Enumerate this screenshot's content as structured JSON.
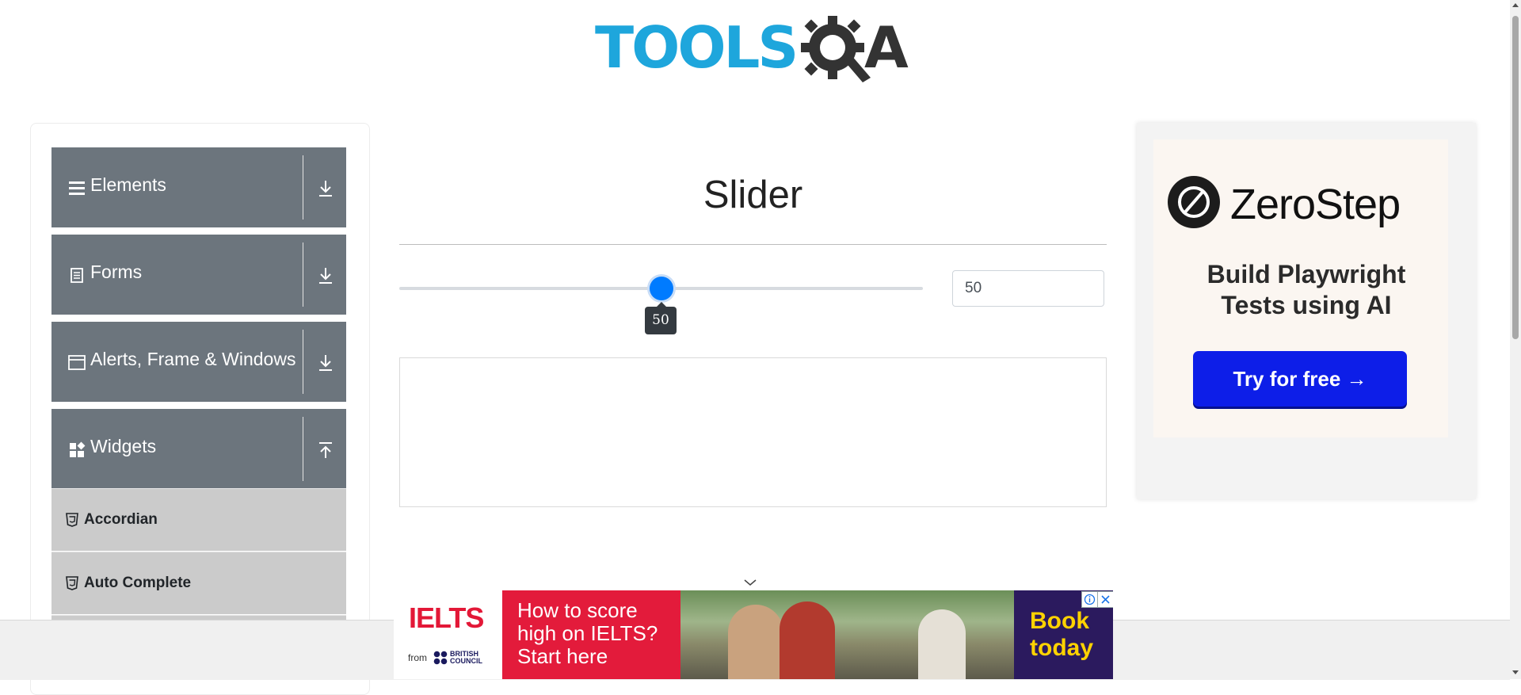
{
  "header": {
    "logo_text": "TOOLS",
    "logo_suffix": "A"
  },
  "sidebar": {
    "groups": [
      {
        "label": "Elements",
        "icon": "hamburger-icon",
        "arrow": "download-icon"
      },
      {
        "label": "Forms",
        "icon": "document-icon",
        "arrow": "download-icon"
      },
      {
        "label": "Alerts, Frame & Windows",
        "icon": "window-icon",
        "arrow": "download-icon"
      },
      {
        "label": "Widgets",
        "icon": "widgets-icon",
        "arrow": "upload-icon"
      }
    ],
    "items": [
      {
        "label": "Accordian",
        "icon": "html5-icon"
      },
      {
        "label": "Auto Complete",
        "icon": "html5-icon"
      }
    ]
  },
  "main": {
    "title": "Slider",
    "slider": {
      "value": "50",
      "tooltip": "50",
      "min": 0,
      "max": 100,
      "accent": "#007bff"
    },
    "input_value": "50"
  },
  "right_ad": {
    "brand": "ZeroStep",
    "headline_line1": "Build Playwright",
    "headline_line2": "Tests using AI",
    "button": "Try for free →"
  },
  "bottom_ad": {
    "logo": "IELTS",
    "from": "from",
    "bc_line1": "BRITISH",
    "bc_line2": "COUNCIL",
    "headline_line1": "How to score",
    "headline_line2": "high on IELTS?",
    "headline_line3": "Start here",
    "cta_line1": "Book",
    "cta_line2": "today"
  },
  "colors": {
    "sidebar_group": "#6c757d",
    "sidebar_item": "#cbcbcb",
    "logo_blue": "#1ea6dc",
    "ad_button": "#0d1ee8"
  }
}
